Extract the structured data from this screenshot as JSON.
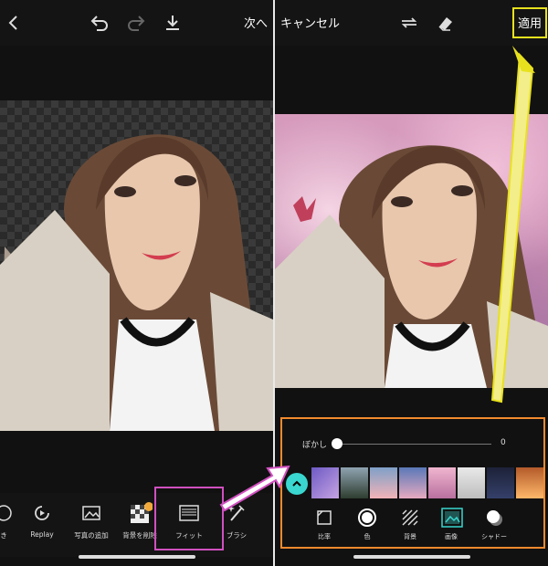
{
  "left": {
    "header": {
      "next_label": "次へ"
    },
    "tools": [
      {
        "label": "き"
      },
      {
        "label": "Replay"
      },
      {
        "label": "写真の追加"
      },
      {
        "label": "背景を削除"
      },
      {
        "label": "フィット"
      },
      {
        "label": "ブラシ"
      }
    ]
  },
  "right": {
    "header": {
      "cancel_label": "キャンセル",
      "apply_label": "適用"
    },
    "blur": {
      "label": "ぼかし",
      "value": "0"
    },
    "options": [
      {
        "label": "比率"
      },
      {
        "label": "色"
      },
      {
        "label": "背景"
      },
      {
        "label": "画像"
      },
      {
        "label": "シャドー"
      }
    ]
  },
  "colors": {
    "accent": "#39d7cf",
    "annotation_yellow": "#e8e11e",
    "annotation_orange": "#f28a2e",
    "annotation_pink": "#d150c0"
  }
}
